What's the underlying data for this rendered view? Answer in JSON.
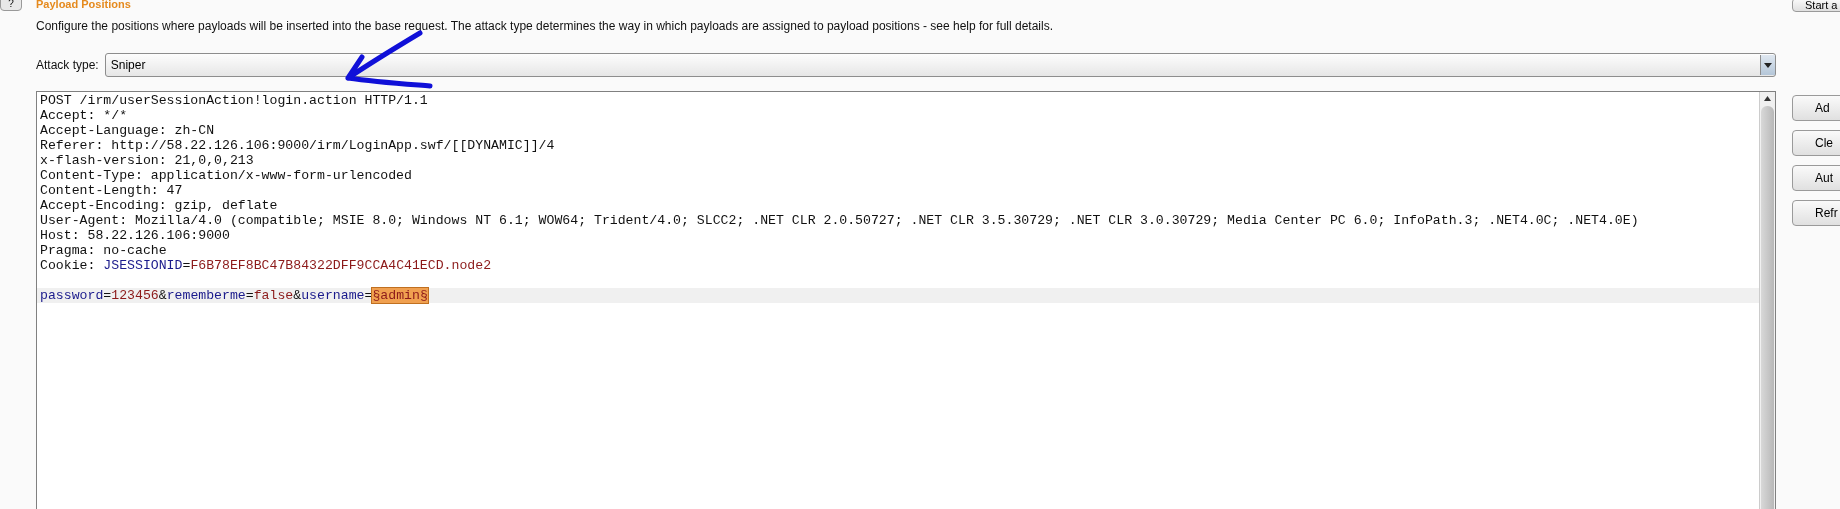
{
  "section": {
    "title": "Payload Positions",
    "help_button": "?",
    "description": "Configure the positions where payloads will be inserted into the base request. The attack type determines the way in which payloads are assigned to payload positions - see help for full details."
  },
  "start_button": "Start a",
  "attack_type": {
    "label": "Attack type:",
    "value": "Sniper"
  },
  "request_lines": [
    {
      "selected": false,
      "segments": [
        {
          "kind": "text",
          "text": "POST /irm/userSessionAction!login.action HTTP/1.1"
        }
      ]
    },
    {
      "selected": false,
      "segments": [
        {
          "kind": "text",
          "text": "Accept: */*"
        }
      ]
    },
    {
      "selected": false,
      "segments": [
        {
          "kind": "text",
          "text": "Accept-Language: zh-CN"
        }
      ]
    },
    {
      "selected": false,
      "segments": [
        {
          "kind": "text",
          "text": "Referer: http://58.22.126.106:9000/irm/LoginApp.swf/[[DYNAMIC]]/4"
        }
      ]
    },
    {
      "selected": false,
      "segments": [
        {
          "kind": "text",
          "text": "x-flash-version: 21,0,0,213"
        }
      ]
    },
    {
      "selected": false,
      "segments": [
        {
          "kind": "text",
          "text": "Content-Type: application/x-www-form-urlencoded"
        }
      ]
    },
    {
      "selected": false,
      "segments": [
        {
          "kind": "text",
          "text": "Content-Length: 47"
        }
      ]
    },
    {
      "selected": false,
      "segments": [
        {
          "kind": "text",
          "text": "Accept-Encoding: gzip, deflate"
        }
      ]
    },
    {
      "selected": false,
      "segments": [
        {
          "kind": "text",
          "text": "User-Agent: Mozilla/4.0 (compatible; MSIE 8.0; Windows NT 6.1; WOW64; Trident/4.0; SLCC2; .NET CLR 2.0.50727; .NET CLR 3.5.30729; .NET CLR 3.0.30729; Media Center PC 6.0; InfoPath.3; .NET4.0C; .NET4.0E)"
        }
      ]
    },
    {
      "selected": false,
      "segments": [
        {
          "kind": "text",
          "text": "Host: 58.22.126.106:9000"
        }
      ]
    },
    {
      "selected": false,
      "segments": [
        {
          "kind": "text",
          "text": "Pragma: no-cache"
        }
      ]
    },
    {
      "selected": false,
      "segments": [
        {
          "kind": "text",
          "text": "Cookie: "
        },
        {
          "kind": "name",
          "text": "JSESSIONID"
        },
        {
          "kind": "text",
          "text": "="
        },
        {
          "kind": "value",
          "text": "F6B78EF8BC47B84322DFF9CCA4C41ECD.node2"
        }
      ]
    },
    {
      "selected": true,
      "blank_before": true,
      "segments": [
        {
          "kind": "name",
          "text": "password"
        },
        {
          "kind": "text",
          "text": "="
        },
        {
          "kind": "value",
          "text": "123456"
        },
        {
          "kind": "text",
          "text": "&"
        },
        {
          "kind": "name",
          "text": "rememberme"
        },
        {
          "kind": "text",
          "text": "="
        },
        {
          "kind": "value",
          "text": "false"
        },
        {
          "kind": "text",
          "text": "&"
        },
        {
          "kind": "name",
          "text": "username"
        },
        {
          "kind": "text",
          "text": "="
        },
        {
          "kind": "payload",
          "text": "§admin§"
        }
      ]
    }
  ],
  "side_buttons": [
    "Ad",
    "Cle",
    "Aut",
    "Refr"
  ]
}
